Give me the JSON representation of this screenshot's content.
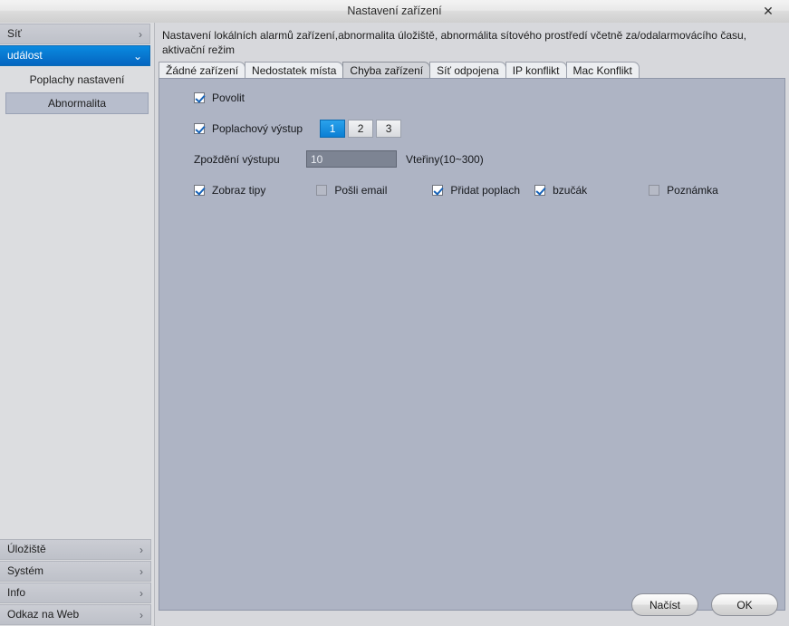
{
  "window": {
    "title": "Nastavení zařízení",
    "close_label": "✕"
  },
  "sidebar": {
    "top_items": [
      {
        "label": "Síť",
        "chevron": "›",
        "active": false
      },
      {
        "label": "událost",
        "chevron": "⌄",
        "active": true
      }
    ],
    "sub_items": [
      {
        "label": "Poplachy nastavení",
        "selected": false
      },
      {
        "label": "Abnormalita",
        "selected": true
      }
    ],
    "bottom_items": [
      {
        "label": "Úložiště",
        "chevron": "›"
      },
      {
        "label": "Systém",
        "chevron": "›"
      },
      {
        "label": "Info",
        "chevron": "›"
      },
      {
        "label": "Odkaz na Web",
        "chevron": "›"
      }
    ]
  },
  "content": {
    "description": "Nastavení lokálních alarmů zařízení,abnormalita úložiště, abnormálita sítového prostředí včetně za/odalarmovácího času, aktivační režim",
    "tabs": [
      {
        "label": "Žádné zařízení",
        "active": false
      },
      {
        "label": "Nedostatek místa",
        "active": false
      },
      {
        "label": "Chyba zařízení",
        "active": true
      },
      {
        "label": "Síť odpojena",
        "active": false
      },
      {
        "label": "IP konflikt",
        "active": false
      },
      {
        "label": "Mac Konflikt",
        "active": false
      }
    ],
    "form": {
      "enable": {
        "label": "Povolit",
        "checked": true
      },
      "alarm_output": {
        "label": "Poplachový výstup",
        "checked": true,
        "options": [
          "1",
          "2",
          "3"
        ],
        "selected": "1"
      },
      "delay": {
        "label": "Zpoždění výstupu",
        "value": "10",
        "placeholder": "",
        "unit": "Vteřiny(10~300)"
      },
      "checkboxes": [
        {
          "label": "Zobraz tipy",
          "checked": true
        },
        {
          "label": "Pošli email",
          "checked": false
        },
        {
          "label": "Přidat poplach",
          "checked": true
        },
        {
          "label": "bzučák",
          "checked": true
        },
        {
          "label": "Poznámka",
          "checked": false
        }
      ]
    },
    "footer": {
      "load_label": "Načíst",
      "ok_label": "OK"
    }
  },
  "colors": {
    "accent": "#0a7fd4",
    "panel": "#aeb4c4",
    "sidebar": "#dcdde0",
    "window": "#d7d8dc"
  }
}
